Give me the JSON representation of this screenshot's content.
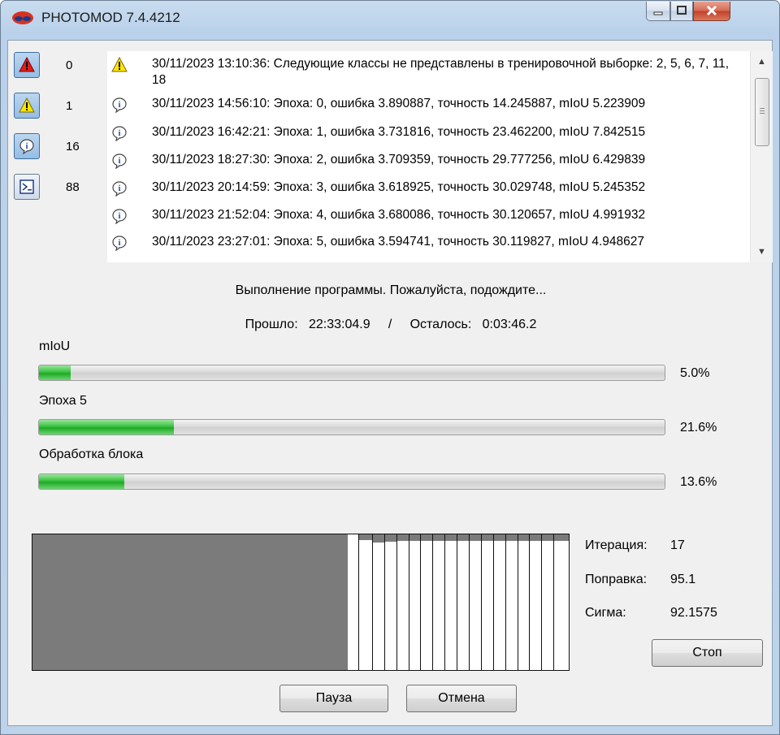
{
  "window": {
    "title": "PHOTOMOD 7.4.4212"
  },
  "filters": [
    {
      "icon": "error-icon",
      "count": "0"
    },
    {
      "icon": "warning-icon",
      "count": "1"
    },
    {
      "icon": "info-icon",
      "count": "16"
    },
    {
      "icon": "console-icon",
      "count": "88"
    }
  ],
  "log": [
    {
      "icon": "warning-icon",
      "text": "30/11/2023 13:10:36: Следующие классы не представлены в тренировочной выборке: 2, 5, 6, 7, 11, 18"
    },
    {
      "icon": "info-icon",
      "text": "30/11/2023 14:56:10: Эпоха: 0, ошибка 3.890887, точность 14.245887, mIoU 5.223909"
    },
    {
      "icon": "info-icon",
      "text": "30/11/2023 16:42:21: Эпоха: 1, ошибка 3.731816, точность 23.462200, mIoU 7.842515"
    },
    {
      "icon": "info-icon",
      "text": "30/11/2023 18:27:30: Эпоха: 2, ошибка 3.709359, точность 29.777256, mIoU 6.429839"
    },
    {
      "icon": "info-icon",
      "text": "30/11/2023 20:14:59: Эпоха: 3, ошибка 3.618925, точность 30.029748, mIoU 5.245352"
    },
    {
      "icon": "info-icon",
      "text": "30/11/2023 21:52:04: Эпоха: 4, ошибка 3.680086, точность 30.120657, mIoU 4.991932"
    },
    {
      "icon": "info-icon",
      "text": "30/11/2023 23:27:01: Эпоха: 5, ошибка 3.594741, точность 30.119827, mIoU 4.948627"
    }
  ],
  "status": {
    "message": "Выполнение программы. Пожалуйста, подождите...",
    "elapsed_label": "Прошло:",
    "elapsed": "22:33:04.9",
    "separator": "/",
    "remaining_label": "Осталось:",
    "remaining": "0:03:46.2"
  },
  "progress": [
    {
      "label": "mIoU",
      "percent": 5.0,
      "percent_text": "5.0%"
    },
    {
      "label": "Эпоха 5",
      "percent": 21.6,
      "percent_text": "21.6%"
    },
    {
      "label": "Обработка блока",
      "percent": 13.6,
      "percent_text": "13.6%"
    }
  ],
  "metrics": {
    "iteration_label": "Итерация:",
    "iteration": "17",
    "correction_label": "Поправка:",
    "correction": "95.1",
    "sigma_label": "Сигма:",
    "sigma": "92.1575"
  },
  "buttons": {
    "stop": "Стоп",
    "pause": "Пауза",
    "cancel": "Отмена"
  },
  "colors": {
    "progress_green": "#2fb836",
    "histogram_gray": "#7b7b7b",
    "title_bar": "#c4d8ee"
  }
}
